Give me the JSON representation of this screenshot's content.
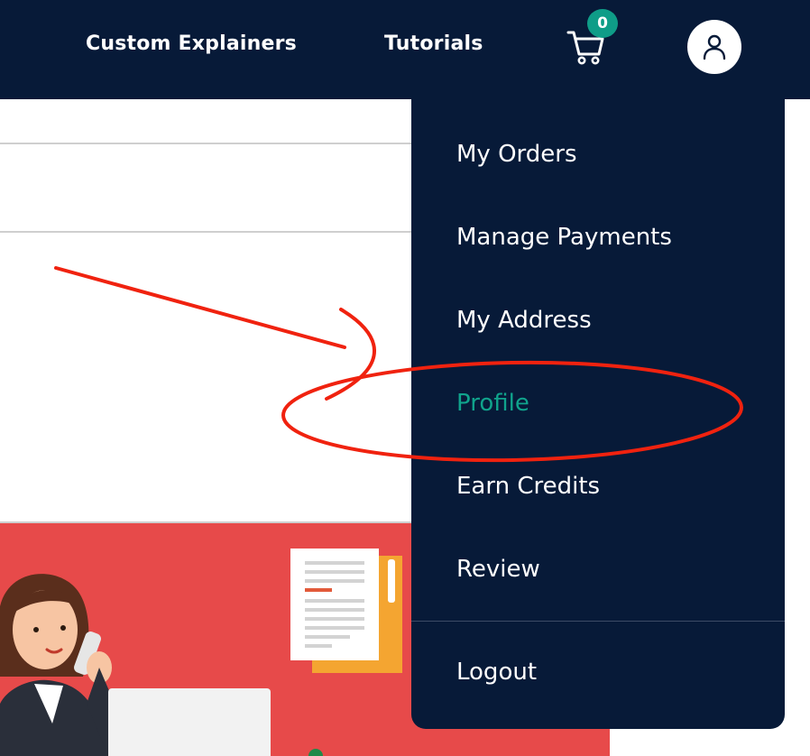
{
  "header": {
    "nav": [
      {
        "label": "Custom Explainers"
      },
      {
        "label": "Tutorials"
      }
    ],
    "cart_count": "0",
    "cart_icon": "shopping-cart-icon",
    "avatar_icon": "user-icon"
  },
  "user_menu": {
    "items": [
      {
        "label": "My Orders"
      },
      {
        "label": "Manage Payments"
      },
      {
        "label": "My Address"
      },
      {
        "label": "Profile",
        "active": true
      },
      {
        "label": "Earn Credits"
      },
      {
        "label": "Review"
      }
    ],
    "logout_label": "Logout"
  },
  "colors": {
    "header_bg": "#071a38",
    "menu_bg": "#071a38",
    "accent": "#10a38c",
    "banner_bg": "#e74a4a",
    "annotation": "#f0220f"
  }
}
